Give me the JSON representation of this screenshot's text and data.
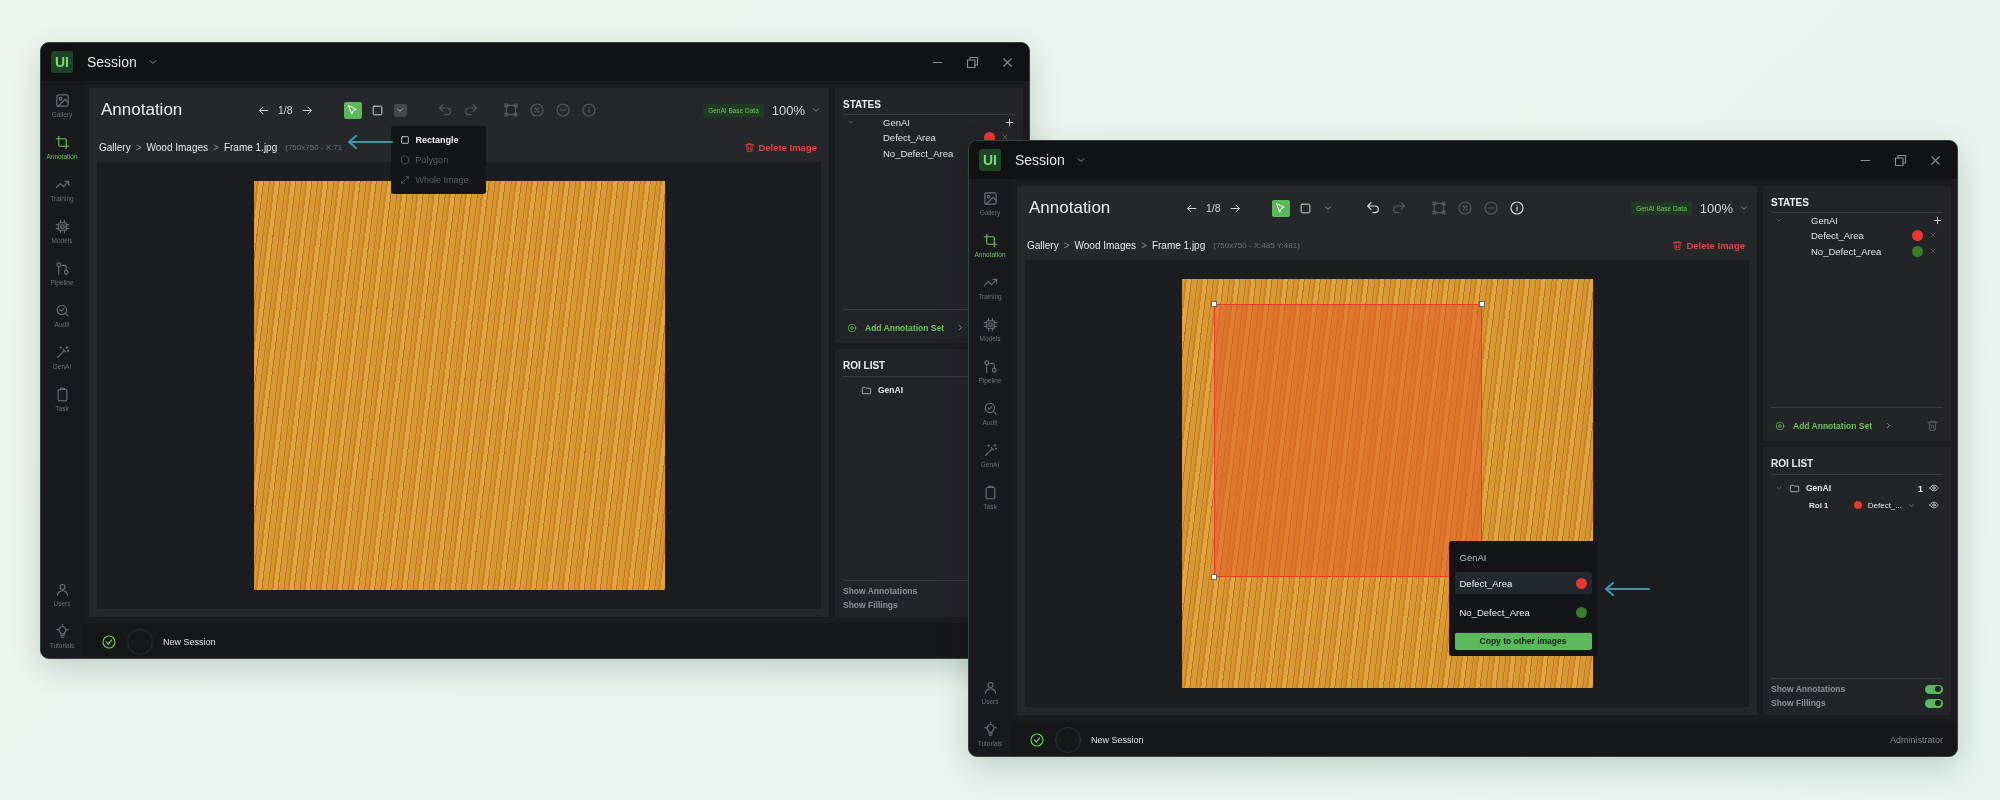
{
  "windows": [
    {
      "logo": "UI",
      "title": "Session",
      "sidebar": {
        "items": [
          {
            "label": "Gallery",
            "selected": false
          },
          {
            "label": "Annotation",
            "selected": true
          },
          {
            "label": "Training",
            "selected": false
          },
          {
            "label": "Models",
            "selected": false
          },
          {
            "label": "Pipeline",
            "selected": false
          },
          {
            "label": "Audit",
            "selected": false
          },
          {
            "label": "GenAI",
            "selected": false
          },
          {
            "label": "Task",
            "selected": false
          }
        ],
        "bottom_items": [
          {
            "label": "Users",
            "selected": false
          },
          {
            "label": "Tutorials",
            "selected": false
          }
        ]
      },
      "header": {
        "title": "Annotation",
        "page": "1/8",
        "tools": [
          {
            "kind": "select",
            "selected": true,
            "disabled": false
          },
          {
            "kind": "rectangle",
            "selected": false,
            "disabled": false
          }
        ],
        "shape_menu": {
          "expanded": true,
          "items": [
            {
              "label": "Rectangle",
              "disabled": false
            },
            {
              "label": "Polygon",
              "disabled": true
            },
            {
              "label": "Whole Image",
              "disabled": true
            }
          ]
        },
        "history": [
          {
            "kind": "undo",
            "disabled": true
          },
          {
            "kind": "redo",
            "disabled": true
          }
        ],
        "actions": [
          {
            "kind": "bounding-box",
            "disabled": true
          },
          {
            "kind": "clear",
            "disabled": true
          },
          {
            "kind": "remove",
            "disabled": true
          },
          {
            "kind": "info",
            "disabled": true
          }
        ],
        "badge": "GenAI Base Data",
        "zoom": "100%"
      },
      "breadcrumb": {
        "items": [
          "Gallery",
          "Wood Images",
          "Frame 1.jpg"
        ],
        "separator": ">",
        "info": "(750x750 - X:71"
      },
      "delete_button": "Delete Image",
      "states": {
        "title": "STATES",
        "groups": [
          {
            "name": "GenAI",
            "children": [
              {
                "name": "Defect_Area",
                "color": "#e8382f"
              },
              {
                "name": "No_Defect_Area"
              }
            ]
          }
        ]
      },
      "add_set": "Add Annotation Set",
      "roi_list": {
        "title": "ROI LIST",
        "folders": [
          {
            "name": "GenAI"
          }
        ]
      },
      "toggles": [
        {
          "label": "Show Annotations"
        },
        {
          "label": "Show Fillings"
        }
      ],
      "status": {
        "session": "New Session"
      }
    },
    {
      "logo": "UI",
      "title": "Session",
      "sidebar": {
        "items": [
          {
            "label": "Gallery",
            "selected": false
          },
          {
            "label": "Annotation",
            "selected": true
          },
          {
            "label": "Training",
            "selected": false
          },
          {
            "label": "Models",
            "selected": false
          },
          {
            "label": "Pipeline",
            "selected": false
          },
          {
            "label": "Audit",
            "selected": false
          },
          {
            "label": "GenAI",
            "selected": false
          },
          {
            "label": "Task",
            "selected": false
          }
        ],
        "bottom_items": [
          {
            "label": "Users",
            "selected": false
          },
          {
            "label": "Tutorials",
            "selected": false
          }
        ]
      },
      "header": {
        "title": "Annotation",
        "page": "1/8",
        "tools": [
          {
            "kind": "select",
            "selected": true,
            "disabled": false
          },
          {
            "kind": "rectangle",
            "selected": false,
            "disabled": false
          }
        ],
        "shape_menu": {
          "expanded": false
        },
        "history": [
          {
            "kind": "undo",
            "disabled": false
          },
          {
            "kind": "redo",
            "disabled": true
          }
        ],
        "actions": [
          {
            "kind": "bounding-box",
            "disabled": true
          },
          {
            "kind": "clear",
            "disabled": true
          },
          {
            "kind": "remove",
            "disabled": true
          },
          {
            "kind": "info",
            "disabled": false
          }
        ],
        "badge": "GenAI Base Data",
        "zoom": "100%"
      },
      "breadcrumb": {
        "items": [
          "Gallery",
          "Wood Images",
          "Frame 1.jpg"
        ],
        "separator": ">",
        "info": "(750x750 - X:485 Y:481)"
      },
      "delete_button": "Delete Image",
      "canvas": {
        "label_menu": {
          "title": "GenAI",
          "items": [
            {
              "name": "Defect_Area",
              "color": "#e8382f",
              "selected": true
            },
            {
              "name": "No_Defect_Area",
              "color": "#3a7d2a",
              "selected": false
            }
          ],
          "button": "Copy to other images"
        }
      },
      "states": {
        "title": "STATES",
        "groups": [
          {
            "name": "GenAI",
            "children": [
              {
                "name": "Defect_Area",
                "color": "#e8382f"
              },
              {
                "name": "No_Defect_Area",
                "color": "#3a7d2a"
              }
            ]
          }
        ]
      },
      "add_set": "Add Annotation Set",
      "roi_list": {
        "title": "ROI LIST",
        "folders": [
          {
            "name": "GenAI",
            "count": "1",
            "children": [
              {
                "name": "Roi 1",
                "label": "Defect_...",
                "color": "#e8382f"
              }
            ]
          }
        ]
      },
      "toggles": [
        {
          "label": "Show Annotations",
          "on": true
        },
        {
          "label": "Show Fillings",
          "on": true
        }
      ],
      "status": {
        "session": "New Session",
        "user": "Administrator"
      }
    }
  ]
}
